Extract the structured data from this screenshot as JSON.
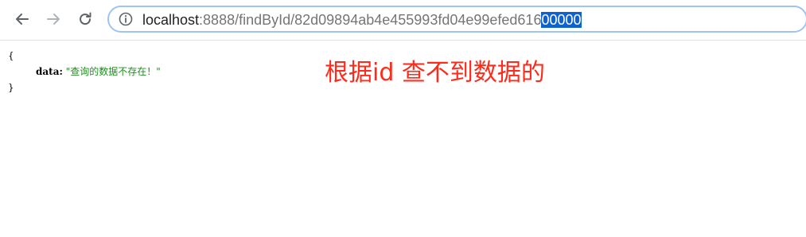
{
  "browser": {
    "icons": {
      "back": "back-arrow-icon",
      "forward": "forward-arrow-icon",
      "reload": "reload-icon",
      "info": "info-icon"
    },
    "address_bar": {
      "host": "localhost",
      "path_unselected": ":8888/findById/82d09894ab4e455993fd04e99efed616",
      "path_selected": "00000"
    }
  },
  "json_view": {
    "open_brace": "{",
    "key": "data",
    "colon": ":",
    "value": "\"查询的数据不存在！\"",
    "close_brace": "}"
  },
  "annotation": {
    "text": "根据id 查不到数据的",
    "color": "#ff2a1a"
  }
}
